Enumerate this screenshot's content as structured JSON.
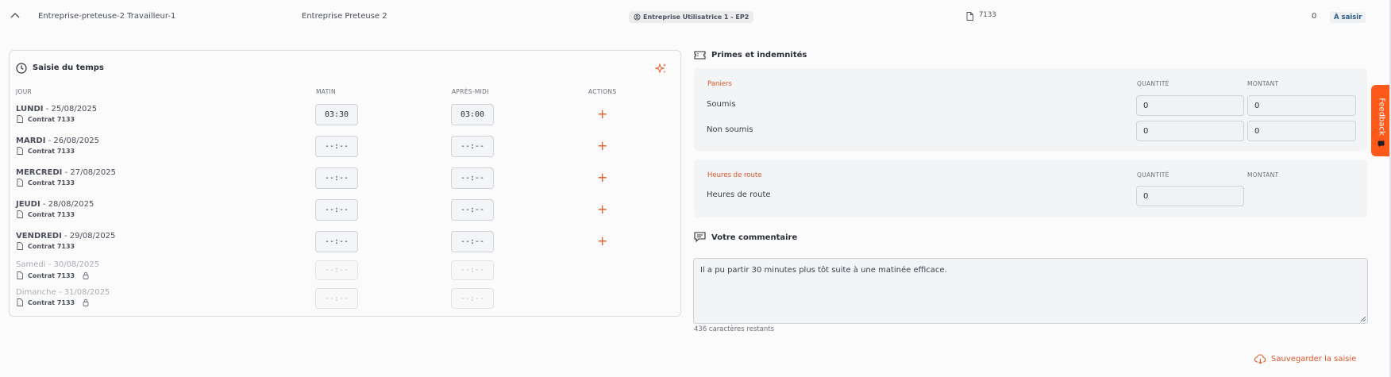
{
  "header": {
    "worker_name": "Entreprise-preteuse-2 Travailleur-1",
    "lender": "Entreprise Preteuse 2",
    "user_company": "Entreprise Utilisatrice 1 - EP2",
    "contract_number": "7133",
    "count": "0",
    "status": "À saisir"
  },
  "time_entry": {
    "title": "Saisie du temps",
    "columns": {
      "day": "JOUR",
      "morning": "MATIN",
      "afternoon": "APRÈS-MIDI",
      "actions": "ACTIONS"
    },
    "rows": [
      {
        "day": "LUNDI",
        "sep": " - ",
        "date": "25/08/2025",
        "contract": "Contrat 7133",
        "morning": "03:30",
        "afternoon": "03:00"
      },
      {
        "day": "MARDI",
        "sep": " - ",
        "date": "26/08/2025",
        "contract": "Contrat 7133",
        "morning": "--:--",
        "afternoon": "--:--"
      },
      {
        "day": "MERCREDI",
        "sep": " - ",
        "date": "27/08/2025",
        "contract": "Contrat 7133",
        "morning": "--:--",
        "afternoon": "--:--"
      },
      {
        "day": "JEUDI",
        "sep": " - ",
        "date": "28/08/2025",
        "contract": "Contrat 7133",
        "morning": "--:--",
        "afternoon": "--:--"
      },
      {
        "day": "VENDREDI",
        "sep": " - ",
        "date": "29/08/2025",
        "contract": "Contrat 7133",
        "morning": "--:--",
        "afternoon": "--:--"
      },
      {
        "day": "Samedi",
        "sep": " - ",
        "date": "30/08/2025",
        "contract": "Contrat 7133",
        "morning": "--:--",
        "afternoon": "--:--"
      },
      {
        "day": "Dimanche",
        "sep": " - ",
        "date": "31/08/2025",
        "contract": "Contrat 7133",
        "morning": "--:--",
        "afternoon": "--:--"
      }
    ],
    "add_symbol": "+"
  },
  "bonuses": {
    "title": "Primes et indemnités",
    "paniers": {
      "section_label": "Paniers",
      "col_quantity": "QUANTITÉ",
      "col_amount": "MONTANT",
      "rows": [
        {
          "label": "Soumis",
          "quantity": "0",
          "amount": "0"
        },
        {
          "label": "Non soumis",
          "quantity": "0",
          "amount": "0"
        }
      ]
    },
    "route": {
      "section_label": "Heures de route",
      "col_quantity": "QUANTITÉ",
      "col_amount": "MONTANT",
      "row_label": "Heures de route",
      "quantity": "0"
    }
  },
  "comment": {
    "title": "Votre commentaire",
    "text": "Il a pu partir 30 minutes plus tôt suite à une matinée efficace.",
    "remaining": "436 caractères restants"
  },
  "save_label": "Sauvegarder la saisie",
  "feedback_label": "Feedback",
  "colors": {
    "accent": "#e25b2a",
    "feedback": "#ff5a1a",
    "status_text": "#2f5a85"
  }
}
